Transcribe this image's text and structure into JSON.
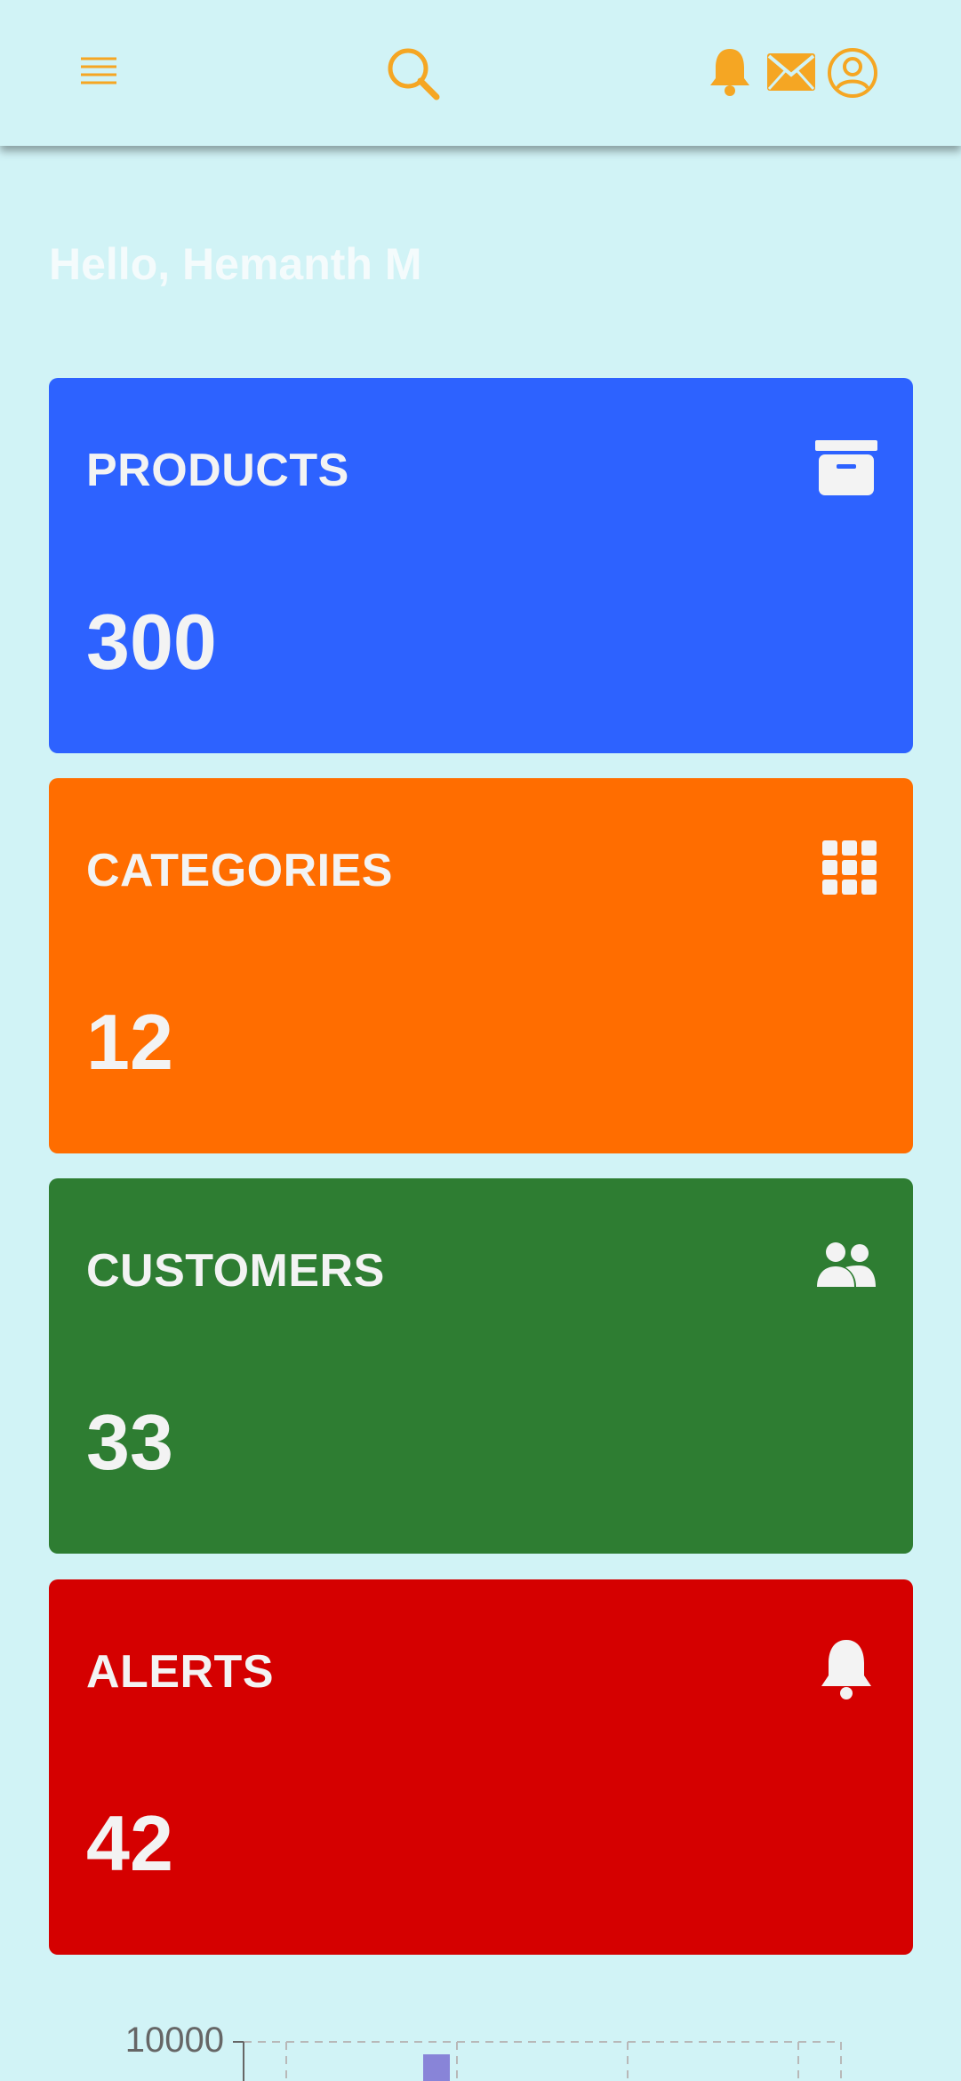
{
  "header": {
    "icons": [
      "menu-icon",
      "search-icon",
      "notification-bell-icon",
      "mail-icon",
      "account-icon"
    ],
    "accent_color": "#f5a623"
  },
  "greeting": "Hello, Hemanth M",
  "cards": [
    {
      "title": "PRODUCTS",
      "value": "300",
      "color": "#2d62ff",
      "icon": "archive-icon"
    },
    {
      "title": "CATEGORIES",
      "value": "12",
      "color": "#ff6d00",
      "icon": "grid-icon"
    },
    {
      "title": "CUSTOMERS",
      "value": "33",
      "color": "#2e7d32",
      "icon": "people-icon"
    },
    {
      "title": "ALERTS",
      "value": "42",
      "color": "#d50000",
      "icon": "bell-icon"
    }
  ],
  "chart_data": {
    "type": "bar",
    "y_tick_labels": [
      "10000"
    ],
    "bar_color": "#8884d8",
    "grid": true
  }
}
